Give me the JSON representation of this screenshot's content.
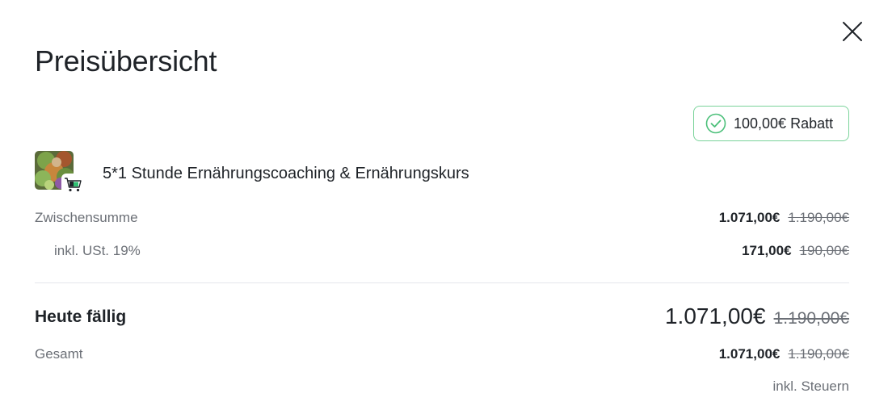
{
  "dialog": {
    "title": "Preisübersicht",
    "close_icon": "close-icon"
  },
  "discount": {
    "label": "100,00€ Rabatt",
    "icon": "check-circle-icon",
    "accent_color": "#4cc07a"
  },
  "product": {
    "name": "5*1 Stunde Ernährungscoaching & Ernährungskurs",
    "thumbnail": "salad-thumbnail",
    "badge_icon": "cart-icon"
  },
  "subtotal": {
    "label": "Zwischensumme",
    "price": "1.071,00€",
    "original_price": "1.190,00€"
  },
  "vat": {
    "label": "inkl. USt. 19%",
    "price": "171,00€",
    "original_price": "190,00€"
  },
  "due_today": {
    "label": "Heute fällig",
    "price": "1.071,00€",
    "original_price": "1.190,00€"
  },
  "total": {
    "label": "Gesamt",
    "price": "1.071,00€",
    "original_price": "1.190,00€",
    "tax_note": "inkl. Steuern"
  }
}
